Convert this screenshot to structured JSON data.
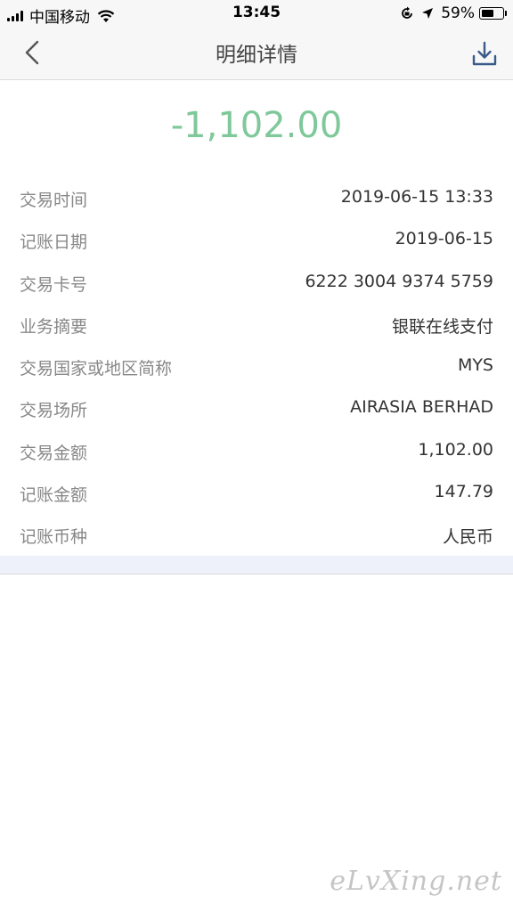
{
  "status_bar": {
    "carrier": "中国移动",
    "time": "13:45",
    "battery": "59%",
    "battery_level": 0.59,
    "icons": [
      "signal-icon",
      "wifi-icon",
      "orientation-lock-icon",
      "location-icon",
      "battery-icon"
    ]
  },
  "nav": {
    "title": "明细详情",
    "back_icon": "chevron-left-icon",
    "download_icon": "download-icon"
  },
  "amount": "-1,102.00",
  "colors": {
    "amount": "#7ec89a",
    "label": "#888888",
    "value": "#333333",
    "band": "#eef1fa"
  },
  "details": [
    {
      "label": "交易时间",
      "value": "2019-06-15 13:33"
    },
    {
      "label": "记账日期",
      "value": "2019-06-15"
    },
    {
      "label": "交易卡号",
      "value": "6222 3004 9374 5759"
    },
    {
      "label": "业务摘要",
      "value": "银联在线支付"
    },
    {
      "label": "交易国家或地区简称",
      "value": "MYS"
    },
    {
      "label": "交易场所",
      "value": "AIRASIA BERHAD"
    },
    {
      "label": "交易金额",
      "value": "1,102.00"
    },
    {
      "label": "记账金额",
      "value": "147.79"
    },
    {
      "label": "记账币种",
      "value": "人民币"
    }
  ],
  "watermark": "eLvXing.net"
}
